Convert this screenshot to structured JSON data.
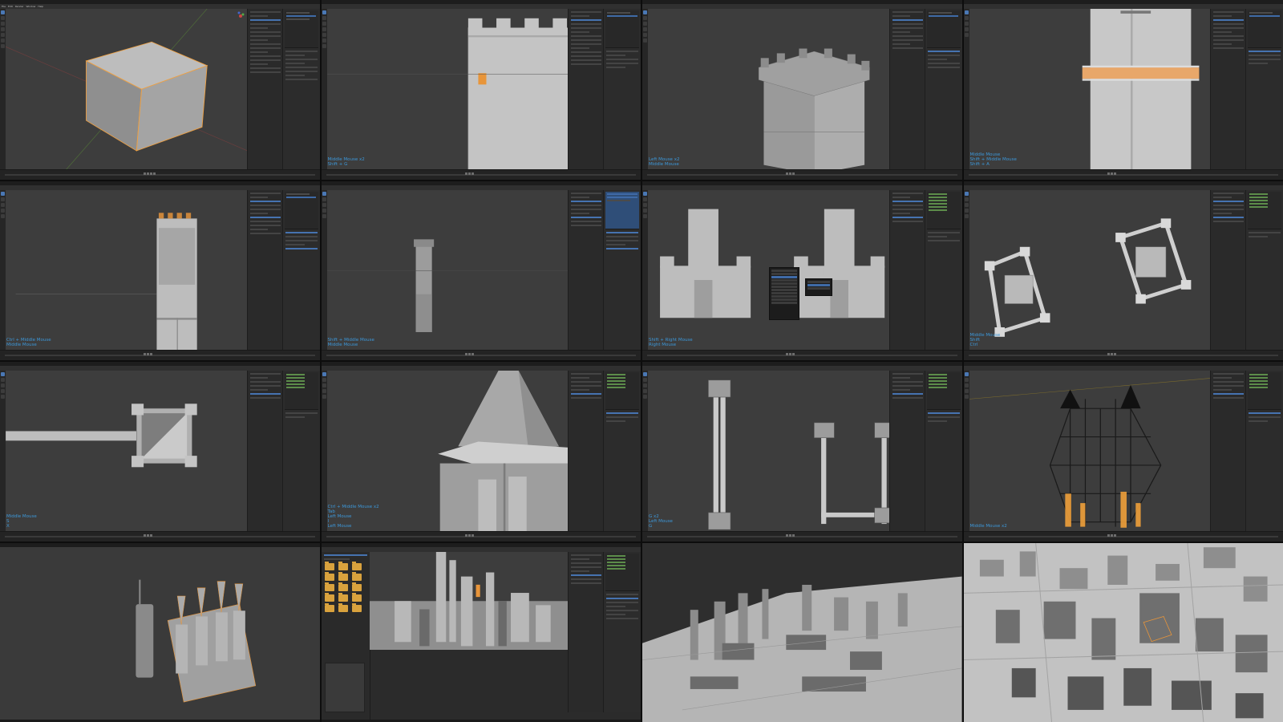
{
  "window": {
    "menu_items": [
      "File",
      "Edit",
      "Render",
      "Window",
      "Help"
    ]
  },
  "panels": [
    {
      "id": "p1",
      "scene": "cube",
      "key_hint": ""
    },
    {
      "id": "p2",
      "scene": "tower-front",
      "key_hint": "Middle Mouse x2\nShift + G"
    },
    {
      "id": "p3",
      "scene": "tower-iso",
      "key_hint": "Left Mouse x2\nMiddle Mouse"
    },
    {
      "id": "p4",
      "scene": "tower-slice",
      "key_hint": "Middle Mouse\nShift + Middle Mouse\nShift + A"
    },
    {
      "id": "p5",
      "scene": "tall-tower",
      "key_hint": "Ctrl + Middle Mouse\nMiddle Mouse"
    },
    {
      "id": "p6",
      "scene": "distant-tower",
      "key_hint": "Shift + Middle Mouse\nMiddle Mouse"
    },
    {
      "id": "p7",
      "scene": "two-keeps-menu",
      "key_hint": "Shift + Right Mouse\nRight Mouse"
    },
    {
      "id": "p8",
      "scene": "bridges",
      "key_hint": "Middle Mouse\nShift\nCtrl"
    },
    {
      "id": "p9",
      "scene": "top-wall",
      "key_hint": "Middle Mouse\nS\nX"
    },
    {
      "id": "p10",
      "scene": "spire",
      "key_hint": "Ctrl + Middle Mouse x2\nTab\nLeft Mouse\nI\nLeft Mouse"
    },
    {
      "id": "p11",
      "scene": "wall-plan",
      "key_hint": "G x2\nLeft Mouse\nG"
    },
    {
      "id": "p12",
      "scene": "wireframe-castle",
      "key_hint": "Middle Mouse x2"
    },
    {
      "id": "p13",
      "scene": "castle-render",
      "key_hint": ""
    },
    {
      "id": "p14",
      "scene": "asset-browser",
      "key_hint": ""
    },
    {
      "id": "p15",
      "scene": "city-aerial",
      "key_hint": ""
    },
    {
      "id": "p16",
      "scene": "city-top",
      "key_hint": ""
    }
  ],
  "colors": {
    "ui_bg": "#2b2b2b",
    "viewport": "#3d3d3d",
    "accent_blue": "#4673b0",
    "hint_blue": "#3d97d8",
    "selection_orange": "#e8953a",
    "folder": "#d9a23d"
  },
  "icons": [
    "move-tool-icon",
    "rotate-tool-icon",
    "scale-tool-icon",
    "navigation-gizmo-icon",
    "play-icon",
    "folder-icon"
  ]
}
